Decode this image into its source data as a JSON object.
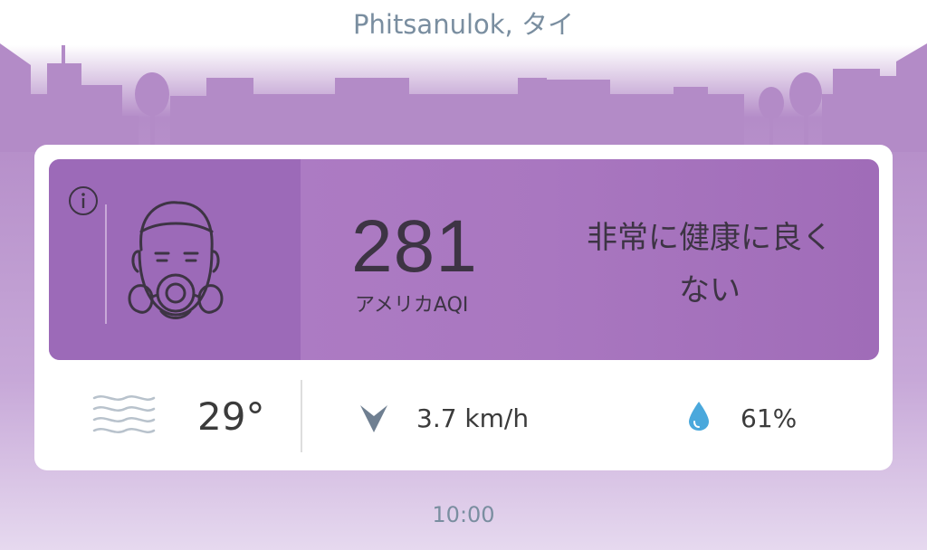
{
  "header": {
    "location": "Phitsanulok, タイ"
  },
  "aqi": {
    "value": "281",
    "unit_label": "アメリカAQI",
    "status_line1": "非常に健康に良く",
    "status_line2": "ない",
    "panel_color": "#a977c0",
    "icons": {
      "info": "info-icon",
      "face": "gas-mask-face-icon"
    }
  },
  "weather": {
    "temperature": "29°",
    "wind": "3.7 km/h",
    "humidity": "61%",
    "icons": {
      "condition": "haze-icon",
      "wind": "wind-direction-icon",
      "humidity": "water-drop-icon"
    },
    "drop_color": "#4aa8dc"
  },
  "footer": {
    "time": "10:00"
  }
}
